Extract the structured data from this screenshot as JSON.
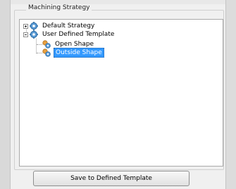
{
  "group": {
    "title": "Machining Strategy"
  },
  "tree": {
    "items": [
      {
        "label": "Default Strategy",
        "expander": "+",
        "icon": "gear-icon"
      },
      {
        "label": "User Defined Template",
        "expander": "-",
        "icon": "gear-icon"
      },
      {
        "label": "Open Shape",
        "icon": "gear-cluster-icon"
      },
      {
        "label": "Outside Shape",
        "icon": "gear-cluster-icon",
        "selected": true
      }
    ]
  },
  "save_button": {
    "label": "Save to Defined Template"
  },
  "colors": {
    "selection": "#3399ff",
    "gear_blue": "#5b9bd5",
    "gear_orange": "#e8a040"
  }
}
